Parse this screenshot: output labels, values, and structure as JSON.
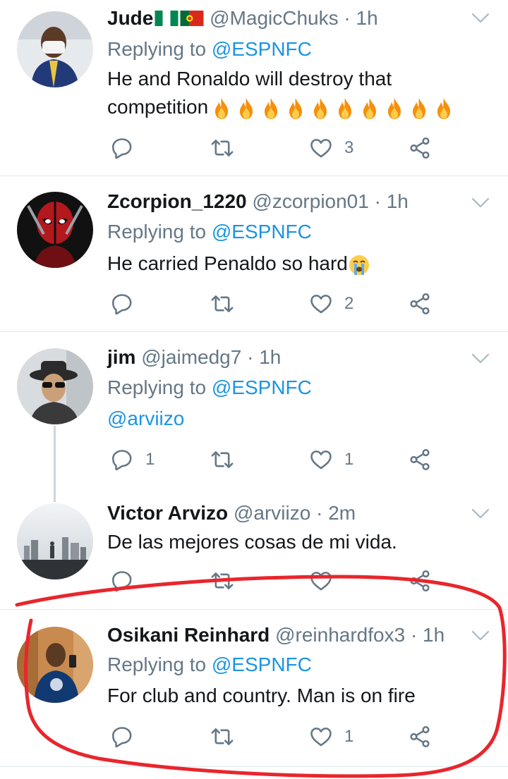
{
  "tweets": [
    {
      "name": "Jude",
      "handle": "@MagicChuks",
      "sep": "·",
      "time": "1h",
      "replying_prefix": "Replying to ",
      "replying_to": "@ESPNFC",
      "text_line1": "He and Ronaldo will destroy that",
      "text_line2": "competition",
      "reply_count": "",
      "retweet_count": "",
      "like_count": "3"
    },
    {
      "name": "Zcorpion_1220",
      "handle": "@zcorpion01",
      "sep": "·",
      "time": "1h",
      "replying_prefix": "Replying to ",
      "replying_to": "@ESPNFC",
      "text": "He carried Penaldo so hard",
      "reply_count": "",
      "retweet_count": "",
      "like_count": "2"
    },
    {
      "name": "jim",
      "handle": "@jaimedg7",
      "sep": "·",
      "time": "1h",
      "replying_prefix": "Replying to ",
      "replying_to": "@ESPNFC",
      "text": "@arviizo",
      "reply_count": "1",
      "retweet_count": "",
      "like_count": "1"
    },
    {
      "name": "Victor Arvizo",
      "handle": "@arviizo",
      "sep": "·",
      "time": "2m",
      "text": "De las mejores cosas de mi vida."
    },
    {
      "name": "Osikani Reinhard",
      "handle": "@reinhardfox3",
      "sep": "·",
      "time": "1h",
      "replying_prefix": "Replying to ",
      "replying_to": "@ESPNFC",
      "text": "For club and country. Man is on fire",
      "reply_count": "",
      "retweet_count": "",
      "like_count": "1"
    }
  ],
  "colors": {
    "text": "#14171a",
    "secondary": "#657786",
    "link": "#1b95e0",
    "divider": "#e1e8ed",
    "annotation": "#e8262c"
  },
  "icons": [
    "reply-icon",
    "retweet-icon",
    "like-icon",
    "share-icon",
    "chevron-down-icon",
    "fire-emoji",
    "crying-face-emoji",
    "nigeria-flag",
    "portugal-flag"
  ]
}
